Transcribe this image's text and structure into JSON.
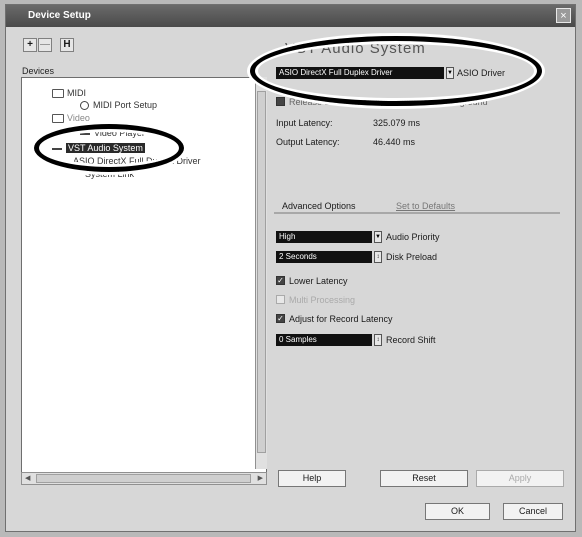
{
  "window": {
    "title": "Device Setup",
    "close_glyph": "×"
  },
  "toolbar": {
    "add": "+",
    "remove": "—",
    "reset": "H"
  },
  "devices": {
    "label": "Devices",
    "tree": [
      {
        "label": "MIDI",
        "icon": "folder-icon"
      },
      {
        "label": "MIDI Port Setup",
        "icon": "port-icon"
      },
      {
        "label": "Video",
        "icon": "folder-icon"
      },
      {
        "label": "Video Player",
        "icon": "video-icon"
      },
      {
        "label": "VST Audio System",
        "icon": "audio-icon",
        "selected": true
      },
      {
        "label": "ASIO DirectX Full Duplex Driver",
        "icon": "driver-icon"
      },
      {
        "label": "System Link",
        "icon": "link-icon"
      }
    ]
  },
  "panel": {
    "title": "VST Audio System",
    "asio_driver_value": "ASIO DirectX Full Duplex Driver",
    "asio_driver_label": "ASIO Driver",
    "release_driver_label": "Release Driver when Application is in Background",
    "input_latency_label": "Input Latency:",
    "input_latency_value": "325.079 ms",
    "output_latency_label": "Output Latency:",
    "output_latency_value": "46.440 ms",
    "tab_advanced": "Advanced Options",
    "tab_defaults": "Set to Defaults",
    "audio_priority_value": "High",
    "audio_priority_label": "Audio Priority",
    "disk_preload_value": "2 Seconds",
    "disk_preload_label": "Disk Preload",
    "lower_latency_label": "Lower Latency",
    "multi_processing_label": "Multi Processing",
    "adjust_record_label": "Adjust for Record Latency",
    "record_shift_value": "0 Samples",
    "record_shift_label": "Record Shift",
    "checked_glyph": "✓"
  },
  "buttons": {
    "help": "Help",
    "reset": "Reset",
    "apply": "Apply",
    "ok": "OK",
    "cancel": "Cancel"
  }
}
